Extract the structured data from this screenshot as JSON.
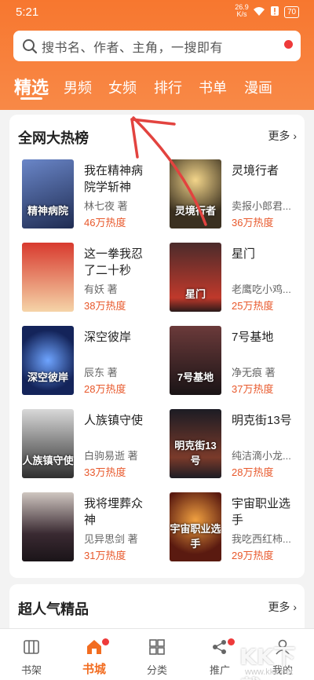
{
  "status": {
    "time": "5:21",
    "speed_value": "26.9",
    "speed_unit": "K/s",
    "battery": "70"
  },
  "search": {
    "placeholder": "搜书名、作者、主角，一搜即有"
  },
  "tabs": [
    "精选",
    "男频",
    "女频",
    "排行",
    "书单",
    "漫画"
  ],
  "section1": {
    "title": "全网大热榜",
    "more": "更多"
  },
  "books": [
    {
      "title": "我在精神病院学斩神",
      "author": "林七夜 著",
      "heat": "46万热度",
      "cover_text": "精神病院",
      "cover_color": "#2c3f6b"
    },
    {
      "title": "灵境行者",
      "author": "卖报小郎君...",
      "heat": "36万热度",
      "cover_text": "灵境行者",
      "cover_color": "#3a3020"
    },
    {
      "title": "这一拳我忍了二十秒",
      "author": "有妖 著",
      "heat": "38万热度",
      "cover_text": "",
      "cover_color": "#c8302a"
    },
    {
      "title": "星门",
      "author": "老鹰吃小鸡...",
      "heat": "25万热度",
      "cover_text": "星门",
      "cover_color": "#2a1a1a"
    },
    {
      "title": "深空彼岸",
      "author": "辰东 著",
      "heat": "28万热度",
      "cover_text": "深空彼岸",
      "cover_color": "#1b2a5e"
    },
    {
      "title": "7号基地",
      "author": "净无痕 著",
      "heat": "37万热度",
      "cover_text": "7号基地",
      "cover_color": "#4a2a2a"
    },
    {
      "title": "人族镇守使",
      "author": "白驹易逝 著",
      "heat": "33万热度",
      "cover_text": "人族镇守使",
      "cover_color": "#3a3a3a"
    },
    {
      "title": "明克街13号",
      "author": "纯洁滴小龙...",
      "heat": "28万热度",
      "cover_text": "明克街13号",
      "cover_color": "#2a2630"
    },
    {
      "title": "我将埋葬众神",
      "author": "见异思剑 著",
      "heat": "31万热度",
      "cover_text": "",
      "cover_color": "#3a2a32"
    },
    {
      "title": "宇宙职业选手",
      "author": "我吃西红柿...",
      "heat": "29万热度",
      "cover_text": "宇宙职业选手",
      "cover_color": "#5a2a1a"
    }
  ],
  "section2": {
    "title": "超人气精品",
    "more": "更多"
  },
  "bottom_nav": [
    "书架",
    "书城",
    "分类",
    "推广",
    "我的"
  ],
  "watermark": {
    "main": "KK下载",
    "url": "www.kkx.net"
  },
  "colors": {
    "accent": "#f26d21",
    "header": "#f7772f",
    "heat": "#e8582b",
    "arrow": "#e2433f"
  }
}
